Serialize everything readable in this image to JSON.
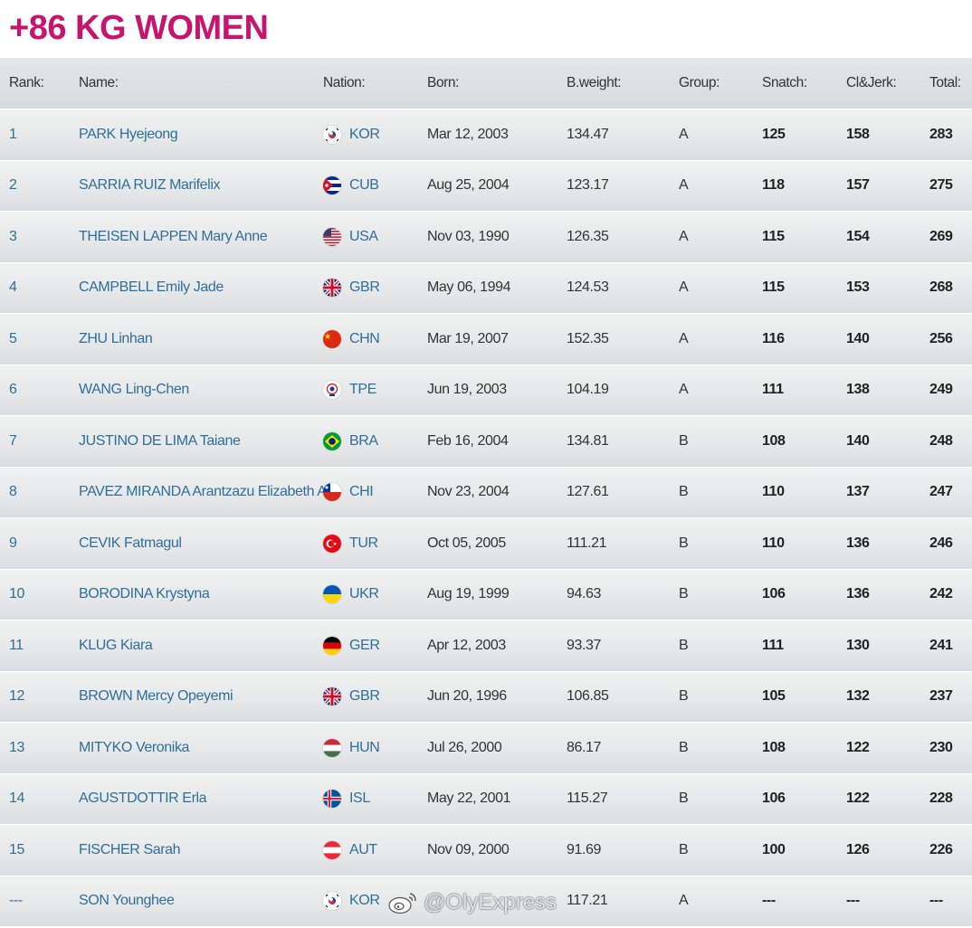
{
  "title": "+86 KG WOMEN",
  "headers": {
    "rank": "Rank:",
    "name": "Name:",
    "nation": "Nation:",
    "born": "Born:",
    "bweight": "B.weight:",
    "group": "Group:",
    "snatch": "Snatch:",
    "cj": "Cl&Jerk:",
    "total": "Total:"
  },
  "rows": [
    {
      "rank": "1",
      "name": "PARK Hyejeong",
      "nation": "KOR",
      "flag": "kor",
      "born": "Mar 12, 2003",
      "bweight": "134.47",
      "group": "A",
      "snatch": "125",
      "cj": "158",
      "total": "283"
    },
    {
      "rank": "2",
      "name": "SARRIA RUIZ Marifelix",
      "nation": "CUB",
      "flag": "cub",
      "born": "Aug 25, 2004",
      "bweight": "123.17",
      "group": "A",
      "snatch": "118",
      "cj": "157",
      "total": "275"
    },
    {
      "rank": "3",
      "name": "THEISEN LAPPEN Mary Anne",
      "nation": "USA",
      "flag": "usa",
      "born": "Nov 03, 1990",
      "bweight": "126.35",
      "group": "A",
      "snatch": "115",
      "cj": "154",
      "total": "269"
    },
    {
      "rank": "4",
      "name": "CAMPBELL Emily Jade",
      "nation": "GBR",
      "flag": "gbr",
      "born": "May 06, 1994",
      "bweight": "124.53",
      "group": "A",
      "snatch": "115",
      "cj": "153",
      "total": "268"
    },
    {
      "rank": "5",
      "name": "ZHU Linhan",
      "nation": "CHN",
      "flag": "chn",
      "born": "Mar 19, 2007",
      "bweight": "152.35",
      "group": "A",
      "snatch": "116",
      "cj": "140",
      "total": "256"
    },
    {
      "rank": "6",
      "name": "WANG Ling-Chen",
      "nation": "TPE",
      "flag": "tpe",
      "born": "Jun 19, 2003",
      "bweight": "104.19",
      "group": "A",
      "snatch": "111",
      "cj": "138",
      "total": "249"
    },
    {
      "rank": "7",
      "name": "JUSTINO DE LIMA Taiane",
      "nation": "BRA",
      "flag": "bra",
      "born": "Feb 16, 2004",
      "bweight": "134.81",
      "group": "B",
      "snatch": "108",
      "cj": "140",
      "total": "248"
    },
    {
      "rank": "8",
      "name": "PAVEZ MIRANDA Arantzazu Elizabeth A",
      "nation": "CHI",
      "flag": "chi",
      "born": "Nov 23, 2004",
      "bweight": "127.61",
      "group": "B",
      "snatch": "110",
      "cj": "137",
      "total": "247"
    },
    {
      "rank": "9",
      "name": "CEVIK Fatmagul",
      "nation": "TUR",
      "flag": "tur",
      "born": "Oct 05, 2005",
      "bweight": "111.21",
      "group": "B",
      "snatch": "110",
      "cj": "136",
      "total": "246"
    },
    {
      "rank": "10",
      "name": "BORODINA Krystyna",
      "nation": "UKR",
      "flag": "ukr",
      "born": "Aug 19, 1999",
      "bweight": "94.63",
      "group": "B",
      "snatch": "106",
      "cj": "136",
      "total": "242"
    },
    {
      "rank": "11",
      "name": "KLUG Kiara",
      "nation": "GER",
      "flag": "ger",
      "born": "Apr 12, 2003",
      "bweight": "93.37",
      "group": "B",
      "snatch": "111",
      "cj": "130",
      "total": "241"
    },
    {
      "rank": "12",
      "name": "BROWN Mercy Opeyemi",
      "nation": "GBR",
      "flag": "gbr",
      "born": "Jun 20, 1996",
      "bweight": "106.85",
      "group": "B",
      "snatch": "105",
      "cj": "132",
      "total": "237"
    },
    {
      "rank": "13",
      "name": "MITYKO Veronika",
      "nation": "HUN",
      "flag": "hun",
      "born": "Jul 26, 2000",
      "bweight": "86.17",
      "group": "B",
      "snatch": "108",
      "cj": "122",
      "total": "230"
    },
    {
      "rank": "14",
      "name": "AGUSTDOTTIR Erla",
      "nation": "ISL",
      "flag": "isl",
      "born": "May 22, 2001",
      "bweight": "115.27",
      "group": "B",
      "snatch": "106",
      "cj": "122",
      "total": "228"
    },
    {
      "rank": "15",
      "name": "FISCHER Sarah",
      "nation": "AUT",
      "flag": "aut",
      "born": "Nov 09, 2000",
      "bweight": "91.69",
      "group": "B",
      "snatch": "100",
      "cj": "126",
      "total": "226"
    },
    {
      "rank": "---",
      "name": "SON Younghee",
      "nation": "KOR",
      "flag": "kor",
      "born": "",
      "bweight": "117.21",
      "group": "A",
      "snatch": "---",
      "cj": "---",
      "total": "---"
    }
  ],
  "watermark": "@OlyExpress",
  "icons": {
    "watermark": "weibo-icon"
  }
}
